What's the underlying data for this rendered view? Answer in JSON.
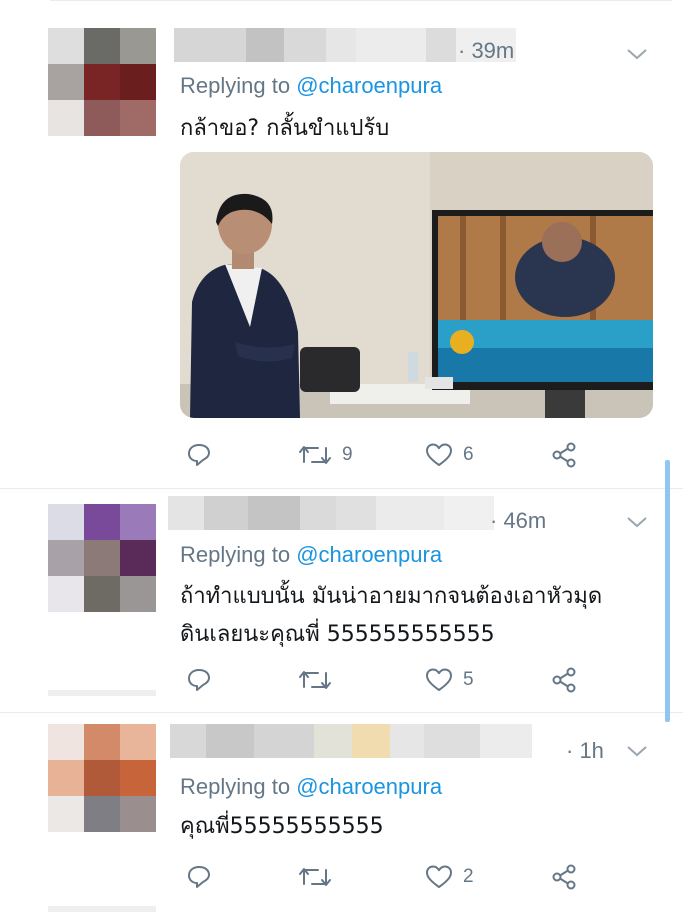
{
  "tweets": [
    {
      "time": "· 39m",
      "replying_label": "Replying to ",
      "handle": "@charoenpura",
      "text_lines": [
        "กล้าขอ? กลั้นขำแปร้บ"
      ],
      "retweets": "9",
      "likes": "6",
      "has_media": true
    },
    {
      "time": "· 46m",
      "replying_label": "Replying to ",
      "handle": "@charoenpura",
      "text_lines": [
        "ถ้าทำแบบนั้น มันน่าอายมากจนต้องเอาหัวมุด",
        "ดินเลยนะคุณพี่ 555555555555"
      ],
      "retweets": "",
      "likes": "5",
      "has_media": false
    },
    {
      "time": "· 1h",
      "replying_label": "Replying to ",
      "handle": "@charoenpura",
      "text_lines": [
        "คุณพี่55555555555"
      ],
      "retweets": "",
      "likes": "2",
      "has_media": false
    }
  ],
  "icons": {
    "reply": "reply-icon",
    "retweet": "retweet-icon",
    "like": "heart-icon",
    "share": "share-icon",
    "caret": "chevron-down-icon"
  },
  "colors": {
    "link": "#1b95e0",
    "secondary_text": "#657786",
    "scroll_accent": "#8fc7f2"
  }
}
